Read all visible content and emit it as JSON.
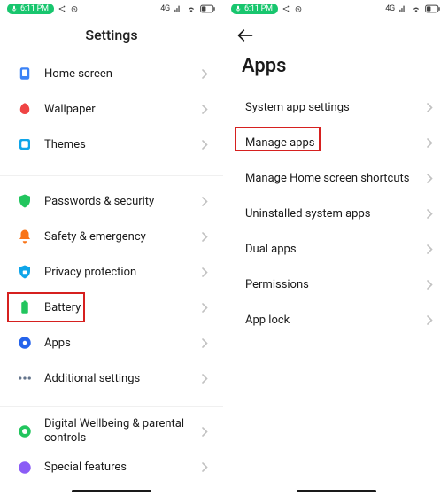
{
  "status": {
    "time": "6:11 PM",
    "signal_label": "4G"
  },
  "left": {
    "title": "Settings",
    "items": [
      {
        "label": "Home screen",
        "icon": "home-screen-icon"
      },
      {
        "label": "Wallpaper",
        "icon": "wallpaper-icon"
      },
      {
        "label": "Themes",
        "icon": "themes-icon"
      }
    ],
    "items2": [
      {
        "label": "Passwords & security",
        "icon": "shield-icon"
      },
      {
        "label": "Safety & emergency",
        "icon": "bell-icon"
      },
      {
        "label": "Privacy protection",
        "icon": "privacy-icon"
      },
      {
        "label": "Battery",
        "icon": "battery-icon"
      },
      {
        "label": "Apps",
        "icon": "gear-icon"
      },
      {
        "label": "Additional settings",
        "icon": "dots-icon"
      }
    ],
    "items3": [
      {
        "label": "Digital Wellbeing & parental controls",
        "icon": "wellbeing-icon"
      },
      {
        "label": "Special features",
        "icon": "special-icon"
      }
    ]
  },
  "right": {
    "title": "Apps",
    "items": [
      {
        "label": "System app settings"
      },
      {
        "label": "Manage apps"
      },
      {
        "label": "Manage Home screen shortcuts"
      },
      {
        "label": "Uninstalled system apps"
      },
      {
        "label": "Dual apps"
      },
      {
        "label": "Permissions"
      },
      {
        "label": "App lock"
      }
    ]
  }
}
